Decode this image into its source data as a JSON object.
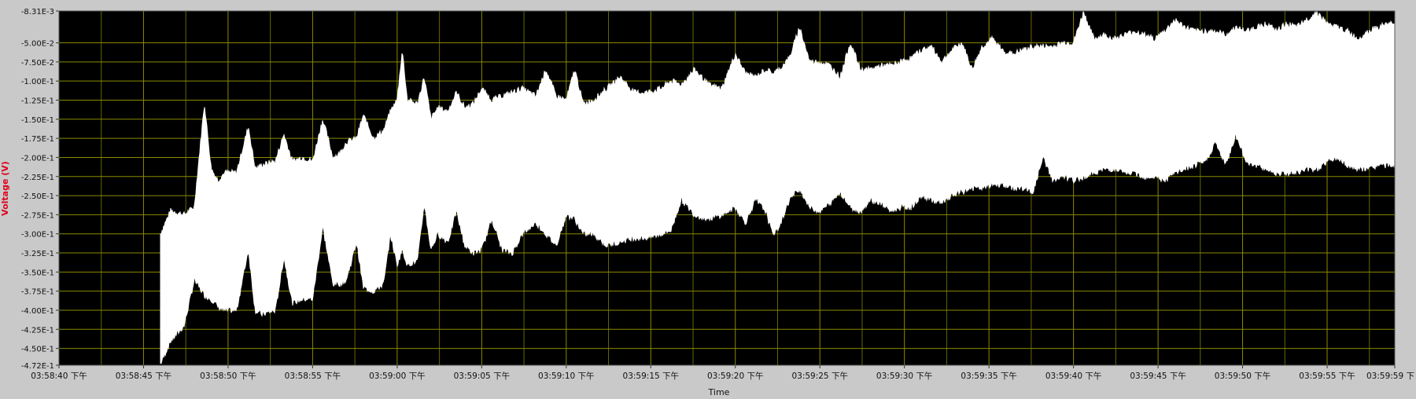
{
  "chart_data": {
    "type": "area",
    "title": "",
    "xlabel": "Time",
    "ylabel": "Voltage (V)",
    "xlim": [
      0,
      79
    ],
    "ylim": [
      -0.472,
      -0.00831
    ],
    "grid": true,
    "colors": {
      "frame": "#c9c9c9",
      "plot_background": "#000000",
      "grid": "#8a8a00",
      "signal": "#ffffff",
      "ylabel": "#e0001a",
      "tick_text": "#111111"
    },
    "y_ticks": [
      {
        "value": -0.00831,
        "label": "-8.31E-3"
      },
      {
        "value": -0.05,
        "label": "-5.00E-2"
      },
      {
        "value": -0.075,
        "label": "-7.50E-2"
      },
      {
        "value": -0.1,
        "label": "-1.00E-1"
      },
      {
        "value": -0.125,
        "label": "-1.25E-1"
      },
      {
        "value": -0.15,
        "label": "-1.50E-1"
      },
      {
        "value": -0.175,
        "label": "-1.75E-1"
      },
      {
        "value": -0.2,
        "label": "-2.00E-1"
      },
      {
        "value": -0.225,
        "label": "-2.25E-1"
      },
      {
        "value": -0.25,
        "label": "-2.50E-1"
      },
      {
        "value": -0.275,
        "label": "-2.75E-1"
      },
      {
        "value": -0.3,
        "label": "-3.00E-1"
      },
      {
        "value": -0.325,
        "label": "-3.25E-1"
      },
      {
        "value": -0.35,
        "label": "-3.50E-1"
      },
      {
        "value": -0.375,
        "label": "-3.75E-1"
      },
      {
        "value": -0.4,
        "label": "-4.00E-1"
      },
      {
        "value": -0.425,
        "label": "-4.25E-1"
      },
      {
        "value": -0.45,
        "label": "-4.50E-1"
      },
      {
        "value": -0.472,
        "label": "-4.72E-1"
      }
    ],
    "x_ticks": [
      {
        "value": 0,
        "label": "03:58:40 下午"
      },
      {
        "value": 5,
        "label": "03:58:45 下午"
      },
      {
        "value": 10,
        "label": "03:58:50 下午"
      },
      {
        "value": 15,
        "label": "03:58:55 下午"
      },
      {
        "value": 20,
        "label": "03:59:00 下午"
      },
      {
        "value": 25,
        "label": "03:59:05 下午"
      },
      {
        "value": 30,
        "label": "03:59:10 下午"
      },
      {
        "value": 35,
        "label": "03:59:15 下午"
      },
      {
        "value": 40,
        "label": "03:59:20 下午"
      },
      {
        "value": 45,
        "label": "03:59:25 下午"
      },
      {
        "value": 50,
        "label": "03:59:30 下午"
      },
      {
        "value": 55,
        "label": "03:59:35 下午"
      },
      {
        "value": 60,
        "label": "03:59:40 下午"
      },
      {
        "value": 65,
        "label": "03:59:45 下午"
      },
      {
        "value": 70,
        "label": "03:59:50 下午"
      },
      {
        "value": 75,
        "label": "03:59:55 下午"
      },
      {
        "value": 79,
        "label": "03:59:59 下"
      }
    ],
    "x_minor_ticks": [
      2.5,
      7.5,
      12.5,
      17.5,
      22.5,
      27.5,
      32.5,
      37.5,
      42.5,
      47.5,
      52.5,
      57.5,
      62.5,
      67.5,
      72.5,
      77.5
    ],
    "series": [
      {
        "envelope": {
          "x": [
            6.0,
            6.6,
            7.4,
            8.0,
            8.6,
            9.0,
            9.4,
            9.8,
            10.5,
            11.2,
            11.6,
            12.0,
            12.8,
            13.3,
            13.8,
            14.4,
            15.0,
            15.6,
            16.2,
            16.6,
            17.0,
            17.6,
            18.0,
            18.6,
            19.2,
            19.6,
            20.0,
            20.3,
            20.6,
            21.2,
            21.6,
            22.0,
            22.4,
            23.0,
            23.5,
            24.0,
            24.5,
            25.0,
            25.6,
            26.2,
            26.8,
            27.4,
            28.2,
            28.8,
            29.4,
            30.0,
            30.5,
            31.0,
            31.6,
            32.4,
            33.2,
            34.0,
            34.8,
            35.6,
            36.2,
            36.8,
            37.6,
            38.4,
            39.2,
            40.0,
            40.6,
            41.2,
            41.8,
            42.2,
            42.6,
            43.2,
            43.8,
            44.4,
            45.0,
            45.6,
            46.2,
            46.8,
            47.4,
            48.0,
            48.6,
            49.2,
            49.8,
            50.4,
            51.0,
            51.6,
            52.2,
            52.8,
            53.4,
            54.0,
            54.6,
            55.2,
            55.8,
            56.4,
            57.0,
            57.6,
            58.2,
            58.8,
            59.4,
            60.0,
            60.6,
            61.2,
            61.8,
            62.4,
            63.0,
            63.6,
            64.2,
            64.8,
            65.4,
            66.0,
            66.6,
            67.2,
            67.8,
            68.4,
            69.0,
            69.6,
            70.2,
            70.8,
            71.4,
            72.0,
            72.6,
            73.2,
            73.8,
            74.4,
            75.0,
            75.6,
            76.2,
            76.8,
            77.4,
            78.0,
            78.6,
            79.0
          ],
          "upper": [
            -0.3,
            -0.27,
            -0.275,
            -0.265,
            -0.13,
            -0.215,
            -0.23,
            -0.22,
            -0.22,
            -0.16,
            -0.215,
            -0.21,
            -0.205,
            -0.17,
            -0.205,
            -0.2,
            -0.205,
            -0.15,
            -0.2,
            -0.195,
            -0.18,
            -0.175,
            -0.145,
            -0.175,
            -0.165,
            -0.14,
            -0.125,
            -0.06,
            -0.125,
            -0.13,
            -0.095,
            -0.15,
            -0.135,
            -0.14,
            -0.115,
            -0.135,
            -0.13,
            -0.11,
            -0.125,
            -0.12,
            -0.115,
            -0.11,
            -0.12,
            -0.085,
            -0.12,
            -0.125,
            -0.085,
            -0.13,
            -0.125,
            -0.11,
            -0.095,
            -0.115,
            -0.115,
            -0.11,
            -0.1,
            -0.105,
            -0.085,
            -0.105,
            -0.11,
            -0.065,
            -0.09,
            -0.095,
            -0.085,
            -0.09,
            -0.085,
            -0.07,
            -0.03,
            -0.075,
            -0.075,
            -0.08,
            -0.095,
            -0.05,
            -0.085,
            -0.085,
            -0.08,
            -0.08,
            -0.075,
            -0.07,
            -0.06,
            -0.055,
            -0.075,
            -0.06,
            -0.05,
            -0.085,
            -0.055,
            -0.045,
            -0.06,
            -0.065,
            -0.06,
            -0.055,
            -0.055,
            -0.055,
            -0.05,
            -0.05,
            -0.01,
            -0.045,
            -0.04,
            -0.045,
            -0.04,
            -0.035,
            -0.04,
            -0.045,
            -0.035,
            -0.02,
            -0.03,
            -0.035,
            -0.035,
            -0.035,
            -0.04,
            -0.03,
            -0.035,
            -0.03,
            -0.025,
            -0.035,
            -0.025,
            -0.03,
            -0.02,
            -0.01,
            -0.025,
            -0.03,
            -0.035,
            -0.045,
            -0.035,
            -0.03,
            -0.025,
            -0.025
          ],
          "lower": [
            -0.47,
            -0.44,
            -0.42,
            -0.36,
            -0.38,
            -0.385,
            -0.395,
            -0.4,
            -0.4,
            -0.32,
            -0.4,
            -0.405,
            -0.4,
            -0.33,
            -0.39,
            -0.385,
            -0.385,
            -0.29,
            -0.365,
            -0.365,
            -0.36,
            -0.31,
            -0.37,
            -0.375,
            -0.365,
            -0.3,
            -0.34,
            -0.32,
            -0.34,
            -0.335,
            -0.26,
            -0.32,
            -0.3,
            -0.31,
            -0.27,
            -0.315,
            -0.325,
            -0.32,
            -0.28,
            -0.32,
            -0.325,
            -0.3,
            -0.285,
            -0.3,
            -0.315,
            -0.275,
            -0.28,
            -0.3,
            -0.3,
            -0.315,
            -0.31,
            -0.305,
            -0.305,
            -0.3,
            -0.295,
            -0.255,
            -0.275,
            -0.28,
            -0.275,
            -0.265,
            -0.285,
            -0.255,
            -0.27,
            -0.3,
            -0.29,
            -0.255,
            -0.24,
            -0.265,
            -0.27,
            -0.26,
            -0.245,
            -0.265,
            -0.27,
            -0.255,
            -0.26,
            -0.27,
            -0.265,
            -0.265,
            -0.25,
            -0.255,
            -0.26,
            -0.25,
            -0.245,
            -0.24,
            -0.24,
            -0.235,
            -0.235,
            -0.24,
            -0.24,
            -0.245,
            -0.2,
            -0.23,
            -0.225,
            -0.23,
            -0.225,
            -0.22,
            -0.215,
            -0.215,
            -0.22,
            -0.22,
            -0.225,
            -0.225,
            -0.23,
            -0.22,
            -0.215,
            -0.21,
            -0.205,
            -0.18,
            -0.21,
            -0.17,
            -0.205,
            -0.21,
            -0.215,
            -0.22,
            -0.22,
            -0.22,
            -0.215,
            -0.215,
            -0.205,
            -0.2,
            -0.21,
            -0.215,
            -0.215,
            -0.21,
            -0.21,
            -0.21
          ]
        }
      }
    ]
  }
}
